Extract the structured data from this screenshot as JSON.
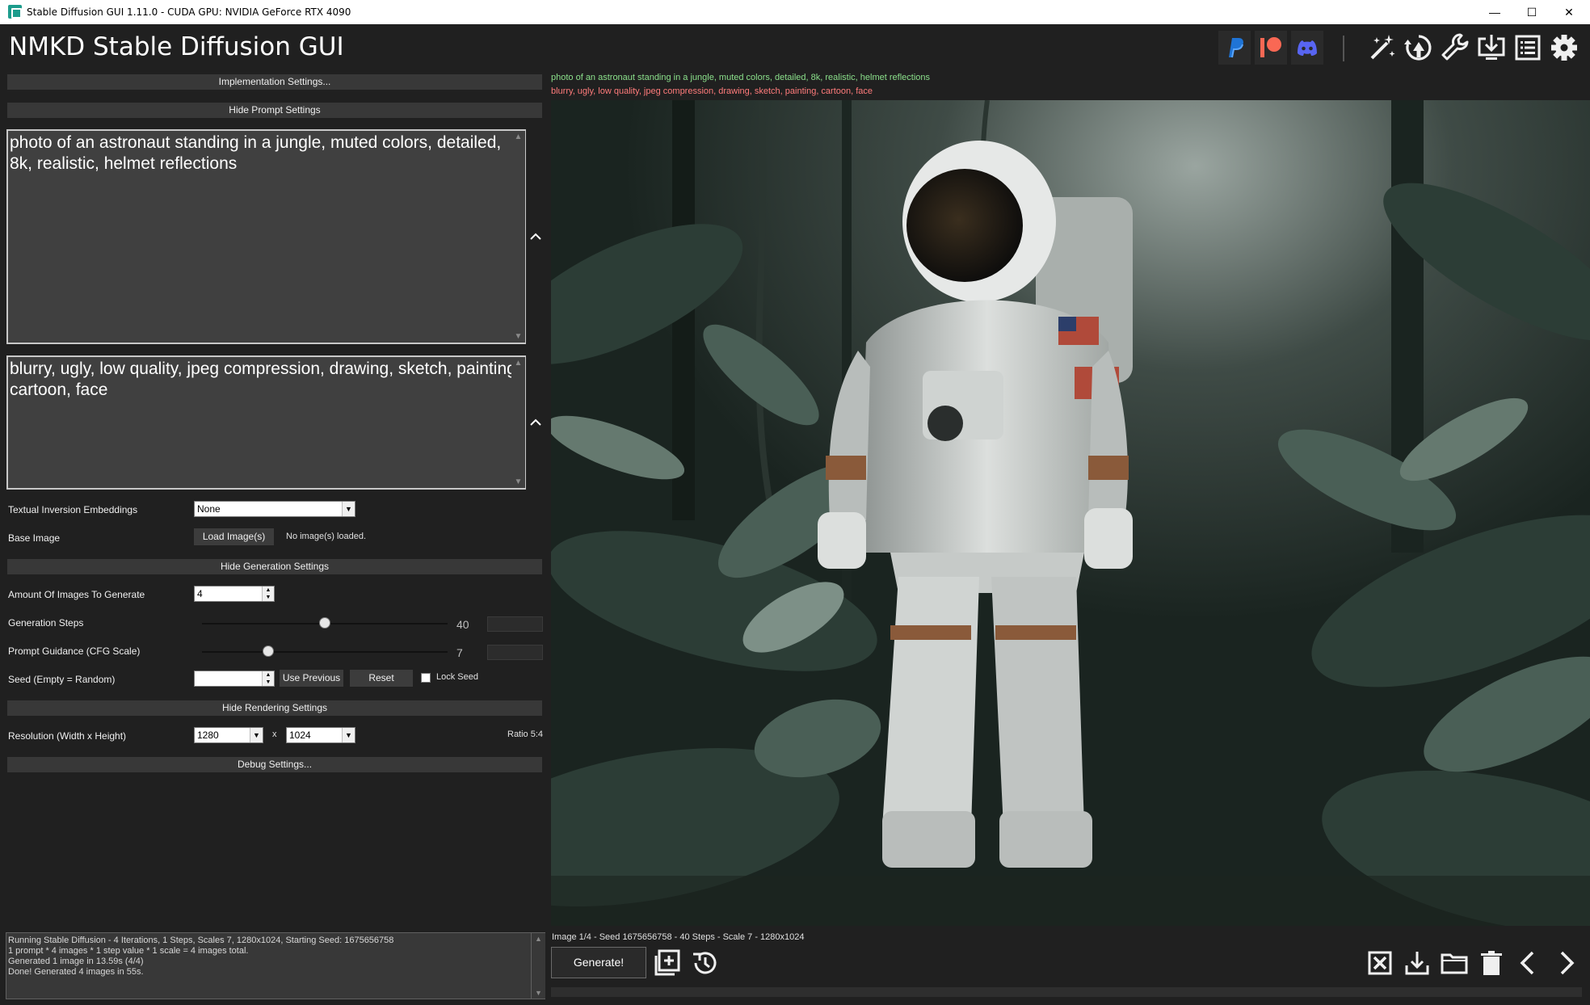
{
  "window": {
    "title": "Stable Diffusion GUI 1.11.0 - CUDA GPU: NVIDIA GeForce RTX 4090",
    "minimize_glyph": "—",
    "maximize_glyph": "☐",
    "close_glyph": "✕"
  },
  "header": {
    "app_title": "NMKD Stable Diffusion GUI",
    "icons": [
      "paypal-icon",
      "patreon-icon",
      "discord-icon",
      "magic-wand-icon",
      "model-merge-icon",
      "wrench-icon",
      "install-icon",
      "log-icon",
      "settings-gear-icon"
    ]
  },
  "sections": {
    "implementation": "Implementation Settings...",
    "prompt": "Hide Prompt Settings",
    "generation": "Hide Generation Settings",
    "rendering": "Hide Rendering Settings",
    "debug": "Debug Settings..."
  },
  "prompt": {
    "positive": "photo of an astronaut standing in a jungle, muted colors, detailed, 8k, realistic, helmet reflections",
    "negative": "blurry, ugly, low quality, jpeg compression, drawing, sketch, painting, cartoon, face"
  },
  "embeddings": {
    "label": "Textual Inversion Embeddings",
    "value": "None"
  },
  "base_image": {
    "label": "Base Image",
    "button": "Load Image(s)",
    "status": "No image(s) loaded."
  },
  "generation": {
    "amount_label": "Amount Of Images To Generate",
    "amount_value": "4",
    "steps_label": "Generation Steps",
    "steps_value": "40",
    "steps_fraction": 0.5,
    "cfg_label": "Prompt Guidance (CFG Scale)",
    "cfg_value": "7",
    "cfg_fraction": 0.27,
    "seed_label": "Seed (Empty = Random)",
    "seed_value": "",
    "use_previous": "Use Previous",
    "reset": "Reset",
    "lock_seed": "Lock Seed"
  },
  "rendering": {
    "resolution_label": "Resolution (Width x Height)",
    "width": "1280",
    "x": "x",
    "height": "1024",
    "ratio": "Ratio 5:4"
  },
  "log": [
    "Running Stable Diffusion - 4 Iterations, 1 Steps, Scales 7, 1280x1024, Starting Seed: 1675656758",
    "1 prompt * 4 images * 1 step value * 1 scale = 4 images total.",
    "Generated 1 image in 13.59s (4/4)",
    "Done! Generated 4 images in 55s."
  ],
  "image_info": {
    "prompt": "photo of an astronaut standing in a jungle, muted colors, detailed, 8k, realistic, helmet reflections",
    "negative": "blurry, ugly, low quality, jpeg compression, drawing, sketch, painting, cartoon, face",
    "status": "Image 1/4 - Seed 1675656758 - 40 Steps - Scale 7 - 1280x1024"
  },
  "toolbar": {
    "generate": "Generate!",
    "bottom_icons": [
      "add-to-queue-icon",
      "history-icon",
      "delete-image-icon",
      "save-image-icon",
      "open-folder-icon",
      "trash-icon",
      "previous-image-icon",
      "next-image-icon"
    ]
  },
  "colors": {
    "background": "#202020",
    "panel_header": "#383838",
    "prompt_positive_text": "#8be08b",
    "prompt_negative_text": "#ff7b7b",
    "patreon": "#f96854",
    "discord": "#5865f2",
    "paypal": "#1f74d6"
  }
}
